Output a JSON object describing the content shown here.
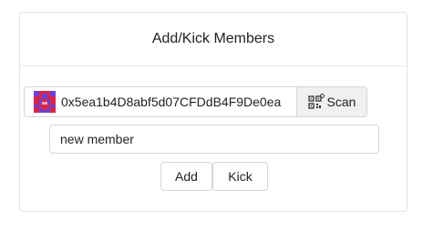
{
  "panel": {
    "title": "Add/Kick Members"
  },
  "address": {
    "value": "0x5ea1b4D8abf5d07CFDdB4F9De0ea",
    "avatar_icon": "blockie-avatar-icon"
  },
  "scan": {
    "label": "Scan",
    "icon": "qr-scan-icon"
  },
  "member_input": {
    "value": "new member",
    "placeholder": ""
  },
  "actions": {
    "add_label": "Add",
    "kick_label": "Kick"
  },
  "colors": {
    "blockie_primary": "#d8264a",
    "blockie_secondary": "#6b3fd8",
    "border": "#d5d5d5",
    "scan_bg": "#f0f0f0"
  }
}
